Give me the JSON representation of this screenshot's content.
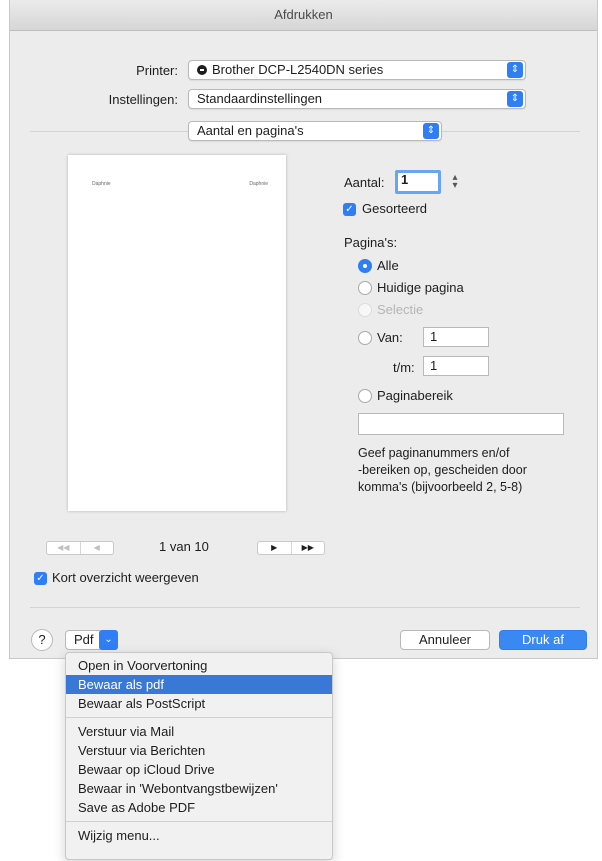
{
  "window": {
    "title": "Afdrukken"
  },
  "printer": {
    "label": "Printer:",
    "value": "Brother DCP-L2540DN series"
  },
  "settings": {
    "label": "Instellingen:",
    "value": "Standaardinstellingen"
  },
  "section_popup": {
    "value": "Aantal en pagina's"
  },
  "copies": {
    "label": "Aantal:",
    "value": "1"
  },
  "collated": {
    "label": "Gesorteerd",
    "checked": true
  },
  "pages": {
    "heading": "Pagina's:",
    "all": "Alle",
    "current": "Huidige pagina",
    "selection": "Selectie",
    "from_label": "Van:",
    "from_value": "1",
    "to_label": "t/m:",
    "to_value": "1",
    "range": "Paginabereik",
    "range_value": "",
    "help_line1": "Geef paginanummers en/of",
    "help_line2": "-bereiken op, gescheiden door",
    "help_line3": "komma's (bijvoorbeeld 2, 5-8)"
  },
  "preview": {
    "header_left": "Daphnie",
    "header_right": "Daphnie",
    "page_indicator": "1 van 10",
    "first_icon": "◀◀",
    "prev_icon": "◀",
    "next_icon": "▶",
    "last_icon": "▶▶"
  },
  "show_summary": {
    "label": "Kort overzicht weergeven",
    "checked": true
  },
  "footer": {
    "help": "?",
    "pdf_label": "Pdf",
    "cancel_label": "Annuleer",
    "print_label": "Druk af"
  },
  "pdf_menu": {
    "group1": [
      "Open in Voorvertoning",
      "Bewaar als pdf",
      "Bewaar als PostScript"
    ],
    "group2": [
      "Verstuur via Mail",
      "Verstuur via Berichten",
      "Bewaar op iCloud Drive",
      "Bewaar in 'Webontvangstbewijzen'",
      "Save as Adobe PDF"
    ],
    "group3": [
      "Wijzig menu..."
    ],
    "highlighted": "Bewaar als pdf"
  },
  "colors": {
    "accent": "#2f7ef5",
    "highlight": "#3a78d8"
  }
}
